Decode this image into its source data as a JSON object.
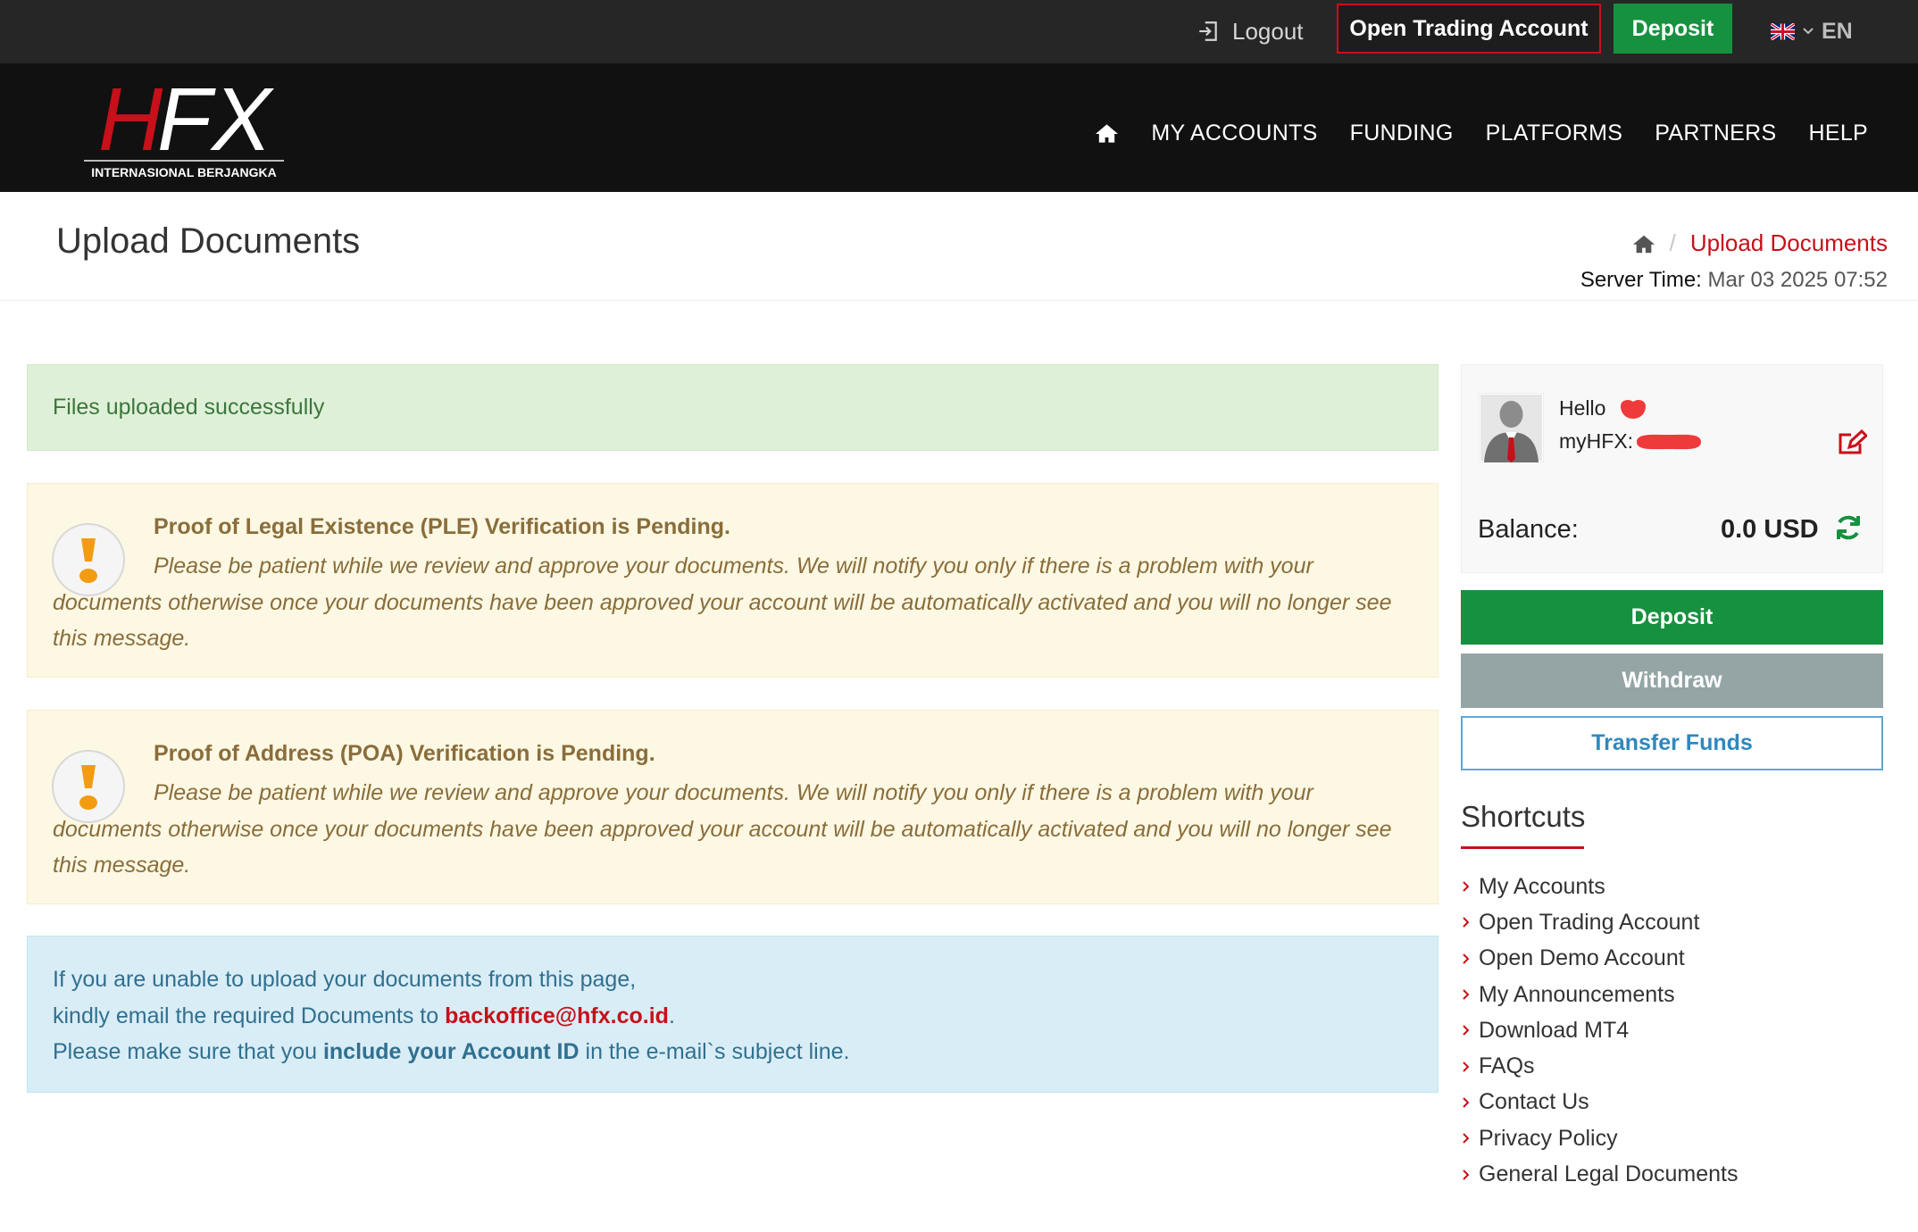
{
  "topbar": {
    "logout_label": "Logout",
    "open_account_label": "Open Trading Account",
    "deposit_label": "Deposit",
    "language": "EN"
  },
  "brand": {
    "logo_text": "HFX",
    "logo_subtitle": "INTERNASIONAL BERJANGKA",
    "accent_color": "#c8101a",
    "green": "#16913f"
  },
  "nav": {
    "items": [
      "MY ACCOUNTS",
      "FUNDING",
      "PLATFORMS",
      "PARTNERS",
      "HELP"
    ]
  },
  "page": {
    "title": "Upload Documents",
    "breadcrumb_current": "Upload Documents",
    "server_time_label": "Server Time:",
    "server_time_value": "Mar 03 2025 07:52"
  },
  "alerts": {
    "success": "Files uploaded successfully",
    "ple": {
      "title": "Proof of Legal Existence (PLE) Verification is Pending.",
      "message": "Please be patient while we review and approve your documents. We will notify you only if there is a problem with your documents otherwise once your documents have been approved your account will be automatically activated and you will no longer see this message."
    },
    "poa": {
      "title": "Proof of Address (POA) Verification is Pending.",
      "message": "Please be patient while we review and approve your documents. We will notify you only if there is a problem with your documents otherwise once your documents have been approved your account will be automatically activated and you will no longer see this message."
    },
    "info": {
      "line1": "If you are unable to upload your documents from this page,",
      "line2_pre": "kindly email the required Documents to",
      "email": "backoffice@hfx.co.id",
      "line2_post": ".",
      "line3_pre": "Please make sure that you",
      "line3_bold": "include your Account ID",
      "line3_post": "in the e-mail`s subject line."
    }
  },
  "profile": {
    "hello_label": "Hello",
    "account_label": "myHFX:",
    "balance_label": "Balance:",
    "balance_value": "0.0 USD"
  },
  "sidebar_buttons": {
    "deposit": "Deposit",
    "withdraw": "Withdraw",
    "transfer": "Transfer Funds"
  },
  "shortcuts": {
    "title": "Shortcuts",
    "items": [
      "My Accounts",
      "Open Trading Account",
      "Open Demo Account",
      "My Announcements",
      "Download MT4",
      "FAQs",
      "Contact Us",
      "Privacy Policy",
      "General Legal Documents"
    ]
  }
}
